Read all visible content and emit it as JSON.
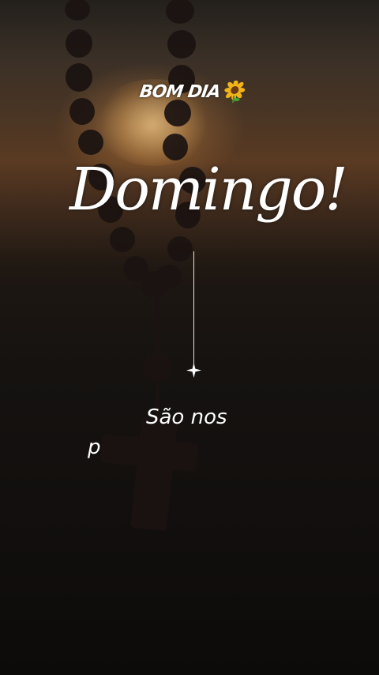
{
  "greeting": {
    "text": "Bom dia",
    "emoji_icon": "sunflower-icon"
  },
  "headline": {
    "text": "Domingo!"
  },
  "caption": {
    "line1": "São nos",
    "line2": "p"
  },
  "colors": {
    "text": "#ffffff",
    "sunset": "#5a3a22",
    "background": "#0c0a09"
  }
}
